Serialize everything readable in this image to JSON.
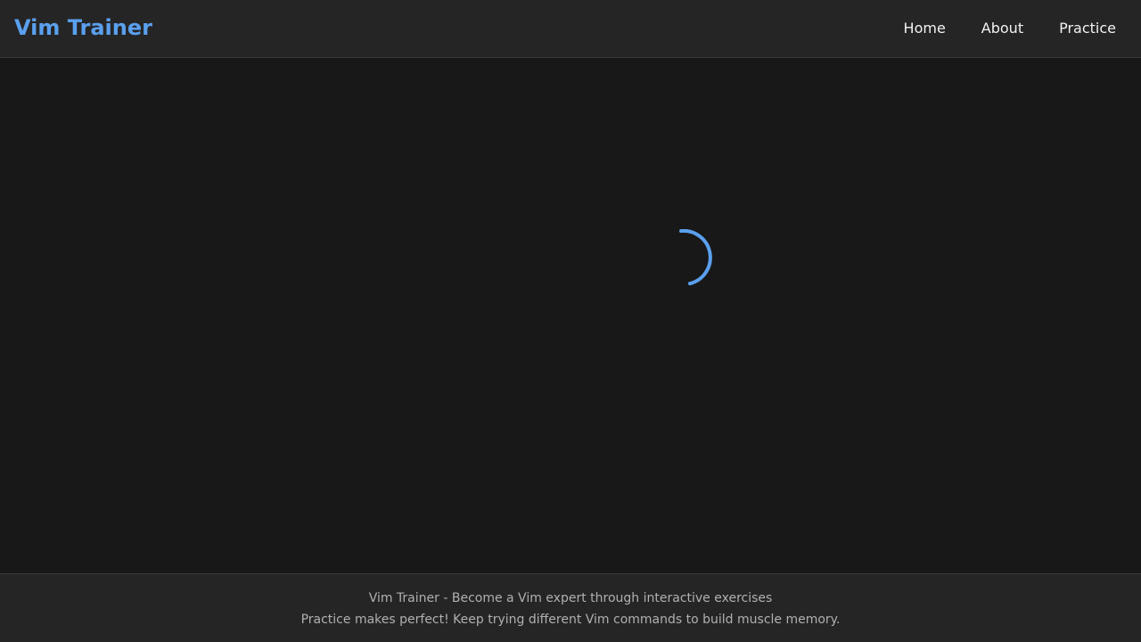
{
  "header": {
    "brand": "Vim Trainer",
    "nav": [
      {
        "label": "Home"
      },
      {
        "label": "About"
      },
      {
        "label": "Practice"
      }
    ]
  },
  "main": {
    "loading_icon": "loading-spinner-icon",
    "accent_color": "#5aa0ee"
  },
  "footer": {
    "line1": "Vim Trainer - Become a Vim expert through interactive exercises",
    "line2": "Practice makes perfect! Keep trying different Vim commands to build muscle memory."
  },
  "colors": {
    "background": "#181818",
    "header_bg": "#252525",
    "accent": "#5aa0ee",
    "nav_text": "#f2f2f2",
    "footer_text": "#b0b0b0"
  }
}
